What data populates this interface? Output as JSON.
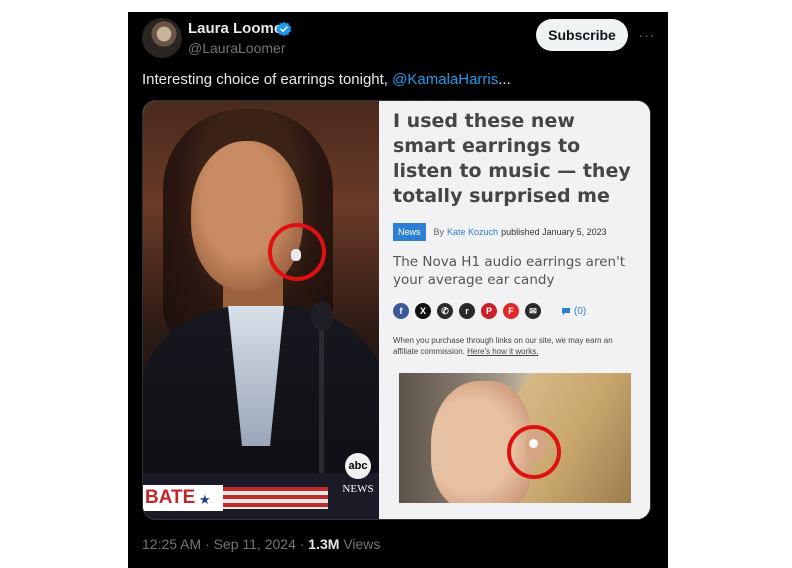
{
  "author": {
    "name": "Laura Loomer",
    "handle": "@LauraLoomer",
    "verified_icon": "verified-badge-icon"
  },
  "actions": {
    "subscribe_label": "Subscribe",
    "more_label": "···"
  },
  "tweet": {
    "text_prefix": "Interesting choice of earrings tonight, ",
    "mention": "@KamalaHarris",
    "text_suffix": "..."
  },
  "image": {
    "left_photo": {
      "banner_text": "BATE",
      "banner_star": "★",
      "network_logo": "abc",
      "network_text": "NEWS"
    },
    "article": {
      "headline": "I used these new smart earrings to listen to music — they totally surprised me",
      "badge": "News",
      "by_label": "By",
      "author": "Kate Kozuch",
      "published": "published January 5, 2023",
      "subhead": "The Nova H1 audio earrings aren't your average ear candy",
      "share_icons": [
        {
          "name": "facebook-icon",
          "glyph": "f",
          "color": "#3b5998"
        },
        {
          "name": "x-icon",
          "glyph": "X",
          "color": "#111111"
        },
        {
          "name": "whatsapp-icon",
          "glyph": "✆",
          "color": "#2a2a2a"
        },
        {
          "name": "reddit-icon",
          "glyph": "r",
          "color": "#2a2a2a"
        },
        {
          "name": "pinterest-icon",
          "glyph": "P",
          "color": "#cb2027"
        },
        {
          "name": "flipboard-icon",
          "glyph": "F",
          "color": "#e12828"
        },
        {
          "name": "email-icon",
          "glyph": "✉",
          "color": "#2a2a2a"
        }
      ],
      "comments_count": "(0)",
      "disclaimer": "When you purchase through links on our site, we may earn an affiliate commission.",
      "disclaimer_link": "Here's how it works."
    }
  },
  "footer": {
    "time": "12:25 AM · Sep 11, 2024 · ",
    "views_count": "1.3M",
    "views_label": " Views"
  },
  "colors": {
    "background": "#000000",
    "accent": "#1d9bf0",
    "highlight_ring": "#e01010",
    "article_badge": "#2d7fd3"
  }
}
